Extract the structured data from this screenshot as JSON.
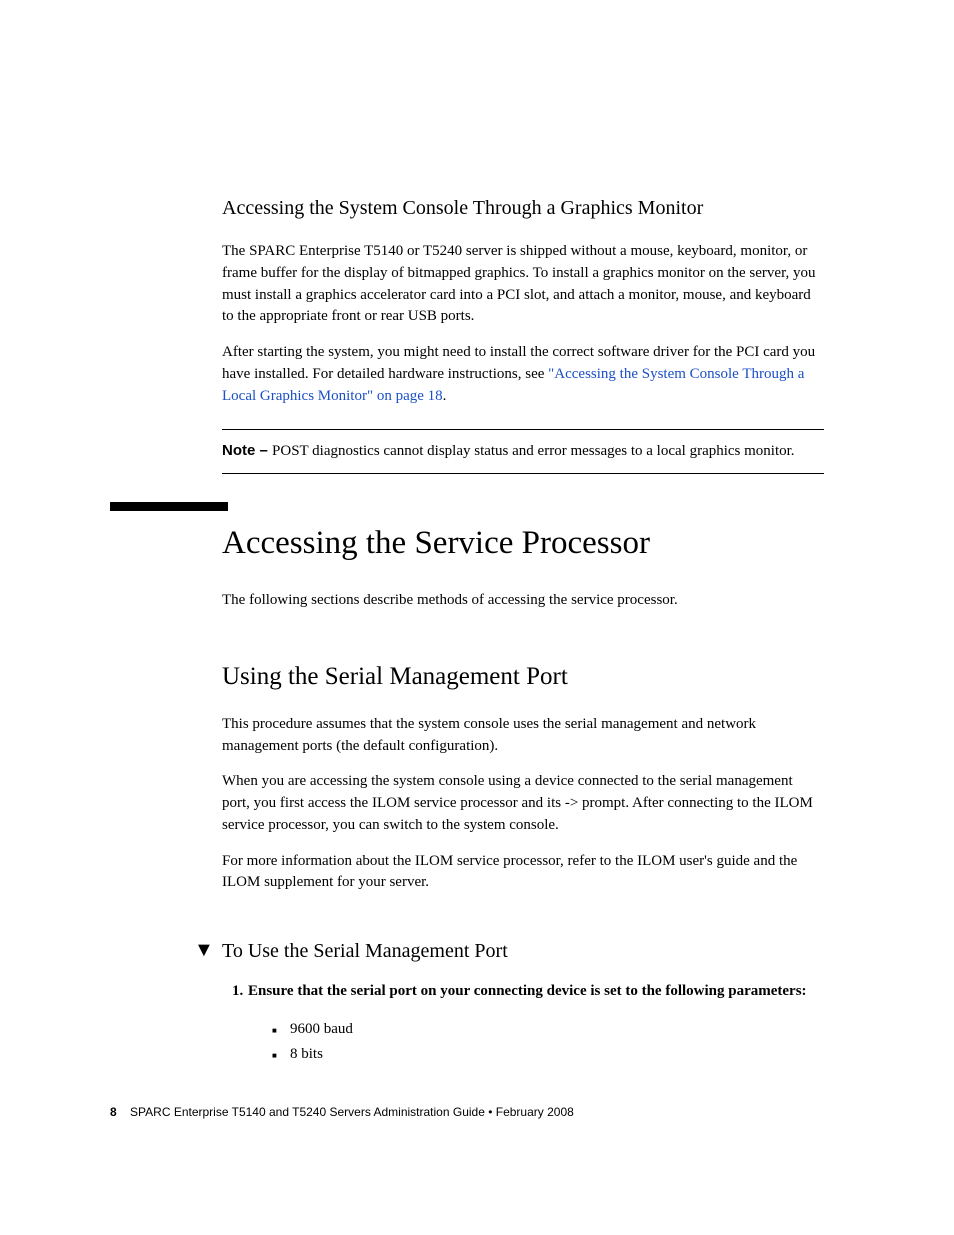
{
  "section1": {
    "heading": "Accessing the System Console Through a Graphics Monitor",
    "p1": "The SPARC Enterprise T5140 or T5240 server is shipped without a mouse, keyboard, monitor, or frame buffer for the display of bitmapped graphics. To install a graphics monitor on the server, you must install a graphics accelerator card into a PCI slot, and attach a monitor, mouse, and keyboard to the appropriate front or rear USB ports.",
    "p2a": "After starting the system, you might need to install the correct software driver for the PCI card you have installed. For detailed hardware instructions, see ",
    "p2link": "\"Accessing the System Console Through a Local Graphics Monitor\" on page 18",
    "p2b": "."
  },
  "note": {
    "label": "Note – ",
    "text": "POST diagnostics cannot display status and error messages to a local graphics monitor."
  },
  "section2": {
    "h1": "Accessing the Service Processor",
    "intro": "The following sections describe methods of accessing the service processor."
  },
  "section3": {
    "h2": "Using the Serial Management Port",
    "p1": "This procedure assumes that the system console uses the serial management and network management ports (the default configuration).",
    "p2": "When you are accessing the system console using a device connected to the serial management port, you first access the ILOM service processor and its -> prompt. After connecting to the ILOM service processor, you can switch to the system console.",
    "p3": "For more information about the ILOM service processor, refer to the ILOM user's guide and the ILOM supplement for your server."
  },
  "procedure": {
    "title": "To Use the Serial Management Port",
    "step1_num": "1.",
    "step1": "Ensure that the serial port on your connecting device is set to the following parameters:",
    "bullets": [
      "9600 baud",
      "8 bits"
    ]
  },
  "footer": {
    "page": "8",
    "text": "SPARC Enterprise T5140 and T5240 Servers Administration Guide  •  February 2008"
  }
}
